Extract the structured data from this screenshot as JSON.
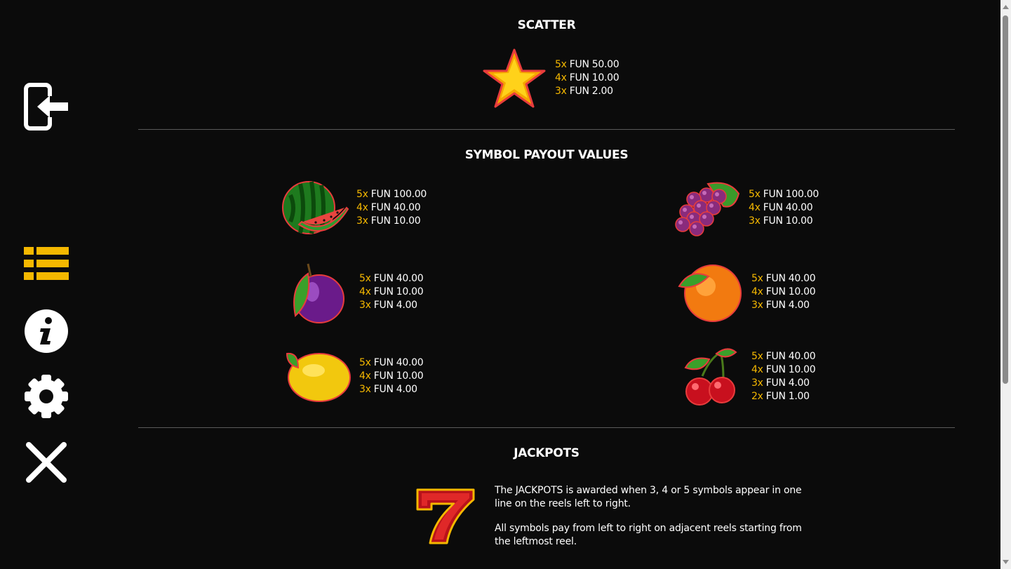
{
  "sidebar": {
    "items": [
      {
        "name": "exit-icon",
        "color": "#ffffff"
      },
      {
        "name": "paytable-icon",
        "color": "#f5b800",
        "active": true
      },
      {
        "name": "info-icon",
        "color": "#ffffff"
      },
      {
        "name": "settings-gear-icon",
        "color": "#ffffff"
      },
      {
        "name": "close-icon",
        "color": "#ffffff"
      }
    ]
  },
  "colors": {
    "multiplier": "#f5b800",
    "text": "#ffffff",
    "background": "#0b0b0b"
  },
  "scatter": {
    "title": "SCATTER",
    "symbol": "star-icon",
    "pays": [
      {
        "mult": "5x",
        "value": "FUN 50.00"
      },
      {
        "mult": "4x",
        "value": "FUN 10.00"
      },
      {
        "mult": "3x",
        "value": "FUN 2.00"
      }
    ]
  },
  "payouts": {
    "title": "SYMBOL PAYOUT VALUES",
    "symbols": [
      {
        "symbol": "watermelon-icon",
        "pays": [
          {
            "mult": "5x",
            "value": "FUN 100.00"
          },
          {
            "mult": "4x",
            "value": "FUN 40.00"
          },
          {
            "mult": "3x",
            "value": "FUN 10.00"
          }
        ]
      },
      {
        "symbol": "grapes-icon",
        "pays": [
          {
            "mult": "5x",
            "value": "FUN 100.00"
          },
          {
            "mult": "4x",
            "value": "FUN 40.00"
          },
          {
            "mult": "3x",
            "value": "FUN 10.00"
          }
        ]
      },
      {
        "symbol": "plum-icon",
        "pays": [
          {
            "mult": "5x",
            "value": "FUN 40.00"
          },
          {
            "mult": "4x",
            "value": "FUN 10.00"
          },
          {
            "mult": "3x",
            "value": "FUN 4.00"
          }
        ]
      },
      {
        "symbol": "orange-icon",
        "pays": [
          {
            "mult": "5x",
            "value": "FUN 40.00"
          },
          {
            "mult": "4x",
            "value": "FUN 10.00"
          },
          {
            "mult": "3x",
            "value": "FUN 4.00"
          }
        ]
      },
      {
        "symbol": "lemon-icon",
        "pays": [
          {
            "mult": "5x",
            "value": "FUN 40.00"
          },
          {
            "mult": "4x",
            "value": "FUN 10.00"
          },
          {
            "mult": "3x",
            "value": "FUN 4.00"
          }
        ]
      },
      {
        "symbol": "cherries-icon",
        "pays": [
          {
            "mult": "5x",
            "value": "FUN 40.00"
          },
          {
            "mult": "4x",
            "value": "FUN 10.00"
          },
          {
            "mult": "3x",
            "value": "FUN 4.00"
          },
          {
            "mult": "2x",
            "value": "FUN 1.00"
          }
        ]
      }
    ]
  },
  "jackpots": {
    "title": "JACKPOTS",
    "symbol": "seven-icon",
    "paragraphs": [
      "The JACKPOTS is awarded when 3, 4 or 5 symbols appear in one line on the reels left to right.",
      "All symbols pay from left to right on adjacent reels starting from the leftmost reel."
    ]
  }
}
